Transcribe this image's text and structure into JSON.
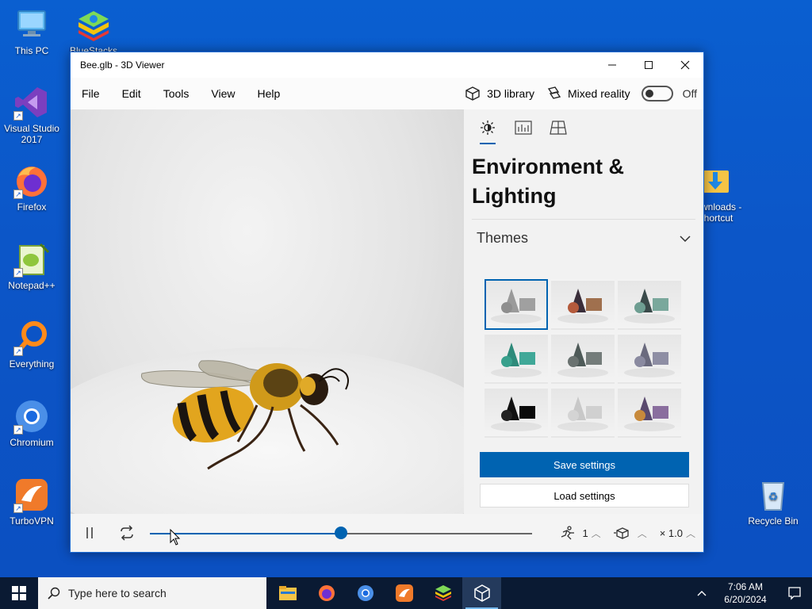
{
  "desktop": {
    "icons": [
      {
        "label": "This PC"
      },
      {
        "label": "BlueStacks"
      },
      {
        "label": "Visual Studio 2017"
      },
      {
        "label": "Firefox"
      },
      {
        "label": "Notepad++"
      },
      {
        "label": "Everything"
      },
      {
        "label": "Chromium"
      },
      {
        "label": "TurboVPN"
      },
      {
        "label": "Downloads - Shortcut"
      },
      {
        "label": "Recycle Bin"
      }
    ]
  },
  "window": {
    "title": "Bee.glb - 3D Viewer",
    "menu": [
      "File",
      "Edit",
      "Tools",
      "View",
      "Help"
    ],
    "toolbar": {
      "library_label": "3D library",
      "mixed_reality_label": "Mixed reality",
      "mixed_reality_state": "Off"
    },
    "panel": {
      "heading": "Environment & Lighting",
      "section": "Themes",
      "themes": [
        {
          "name": "theme-1",
          "selected": true,
          "colors": [
            "#9a9a9a",
            "#8e8e8e",
            "#a0a0a0"
          ]
        },
        {
          "name": "theme-2",
          "selected": false,
          "colors": [
            "#3a2e3a",
            "#b45a3c",
            "#a0704e"
          ]
        },
        {
          "name": "theme-3",
          "selected": false,
          "colors": [
            "#3a4a4a",
            "#6e9e92",
            "#7aa89c"
          ]
        },
        {
          "name": "theme-4",
          "selected": false,
          "colors": [
            "#2e8a7a",
            "#38a08c",
            "#40a898"
          ]
        },
        {
          "name": "theme-5",
          "selected": false,
          "colors": [
            "#4e5a58",
            "#6a7270",
            "#747c7a"
          ]
        },
        {
          "name": "theme-6",
          "selected": false,
          "colors": [
            "#6a6a7e",
            "#8a8aa0",
            "#8e8ea4"
          ]
        },
        {
          "name": "theme-7",
          "selected": false,
          "colors": [
            "#111111",
            "#222222",
            "#0a0a0a"
          ]
        },
        {
          "name": "theme-8",
          "selected": false,
          "colors": [
            "#c8c8c8",
            "#d4d4d4",
            "#d0d0d0"
          ]
        },
        {
          "name": "theme-9",
          "selected": false,
          "colors": [
            "#5a4a6e",
            "#c88a3c",
            "#8a6e9e"
          ]
        }
      ],
      "save_label": "Save settings",
      "load_label": "Load settings"
    },
    "timeline": {
      "progress_percent": 50,
      "animation_index": "1",
      "speed": "× 1.0"
    }
  },
  "taskbar": {
    "search_placeholder": "Type here to search",
    "time": "7:06 AM",
    "date": "6/20/2024"
  },
  "colors": {
    "accent": "#0063b1",
    "desktop": "#0c56c8",
    "taskbar": "#0a1a33"
  }
}
